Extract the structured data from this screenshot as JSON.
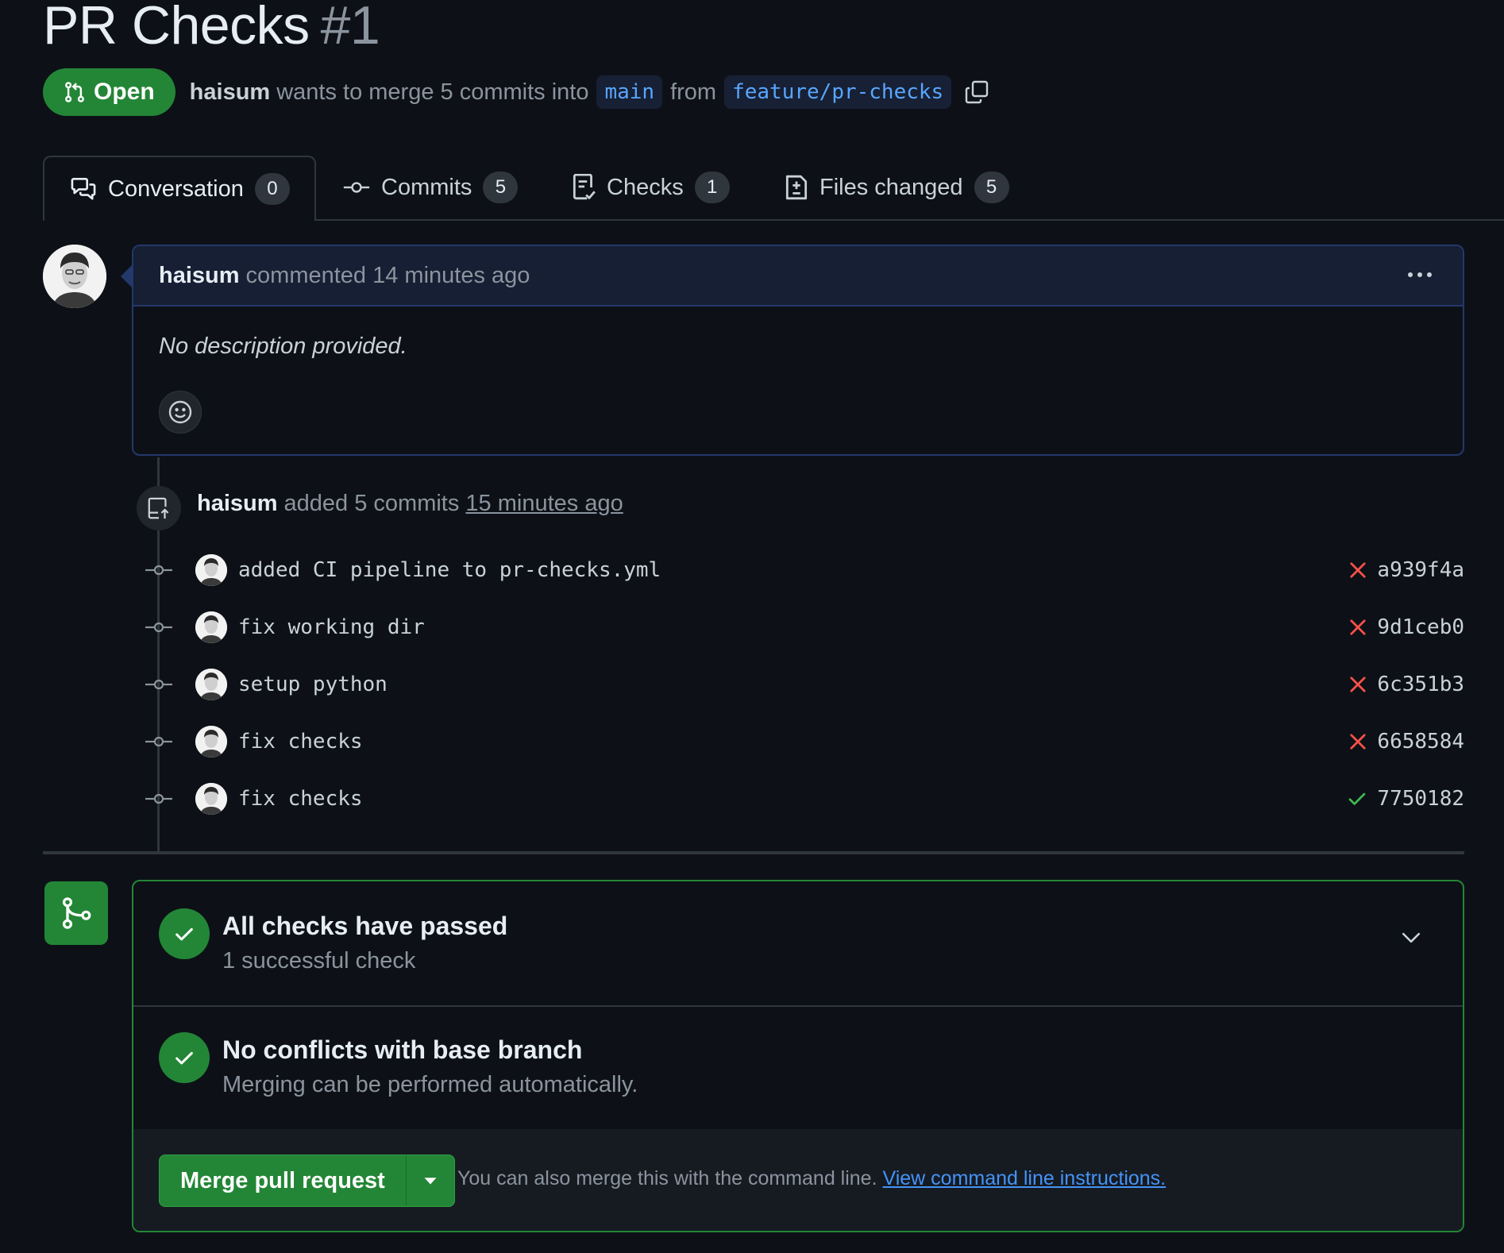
{
  "pr": {
    "title": "PR Checks",
    "number": "#1",
    "state": "Open",
    "author": "haisum",
    "merge_text_1": "wants to merge 5 commits into",
    "base_branch": "main",
    "merge_text_2": "from",
    "head_branch": "feature/pr-checks"
  },
  "tabs": [
    {
      "label": "Conversation",
      "count": "0",
      "icon": "comment-discussion-icon"
    },
    {
      "label": "Commits",
      "count": "5",
      "icon": "git-commit-icon"
    },
    {
      "label": "Checks",
      "count": "1",
      "icon": "checklist-icon"
    },
    {
      "label": "Files changed",
      "count": "5",
      "icon": "file-diff-icon"
    }
  ],
  "comment": {
    "author": "haisum",
    "action": "commented 14 minutes ago",
    "body": "No description provided."
  },
  "push_event": {
    "author": "haisum",
    "action": "added 5 commits",
    "time": "15 minutes ago"
  },
  "commits": [
    {
      "message": "added CI pipeline to pr-checks.yml",
      "sha": "a939f4a",
      "status": "failure"
    },
    {
      "message": "fix working dir",
      "sha": "9d1ceb0",
      "status": "failure"
    },
    {
      "message": "setup python",
      "sha": "6c351b3",
      "status": "failure"
    },
    {
      "message": "fix checks",
      "sha": "6658584",
      "status": "failure"
    },
    {
      "message": "fix checks",
      "sha": "7750182",
      "status": "success"
    }
  ],
  "merge_box": {
    "checks_title": "All checks have passed",
    "checks_sub": "1 successful check",
    "conflicts_title": "No conflicts with base branch",
    "conflicts_sub": "Merging can be performed automatically.",
    "merge_button": "Merge pull request",
    "hint": "You can also merge this with the command line.",
    "hint_link": "View command line instructions."
  },
  "colors": {
    "accent_green": "#238636",
    "failure_red": "#f85149",
    "success_green": "#3fb950",
    "link_blue": "#4493f8"
  }
}
